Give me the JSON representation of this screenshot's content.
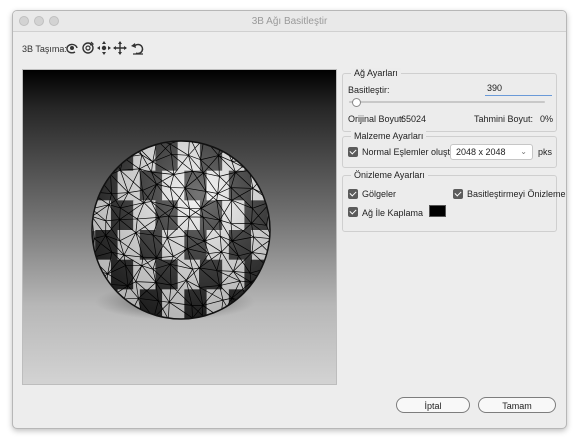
{
  "window": {
    "title": "3B Ağı Basitleştir"
  },
  "toolbar": {
    "label": "3B Taşıma:",
    "tools": [
      "rotate-icon",
      "roll-icon",
      "pan-icon",
      "slide-icon",
      "reset-icon"
    ]
  },
  "mesh_settings": {
    "legend": "Ağ Ayarları",
    "simplify_label": "Basitleştir:",
    "simplify_value": "390",
    "slider_level": 0.02,
    "original_size_label": "Orijinal Boyut:",
    "original_size_value": "65024",
    "estimated_size_label": "Tahmini Boyut:",
    "estimated_size_value": "0%"
  },
  "material_settings": {
    "legend": "Malzeme Ayarları",
    "normal_maps_label": "Normal Eşlemler oluştur",
    "normal_maps_checked": true,
    "size_value": "2048 x 2048",
    "unit": "pks"
  },
  "preview_settings": {
    "legend": "Önizleme Ayarları",
    "shadows_label": "Gölgeler",
    "shadows_checked": true,
    "preview_simplify_label": "Basitleştirmeyi Önizleme",
    "preview_simplify_checked": true,
    "wireframe_label": "Ağ İle Kaplama",
    "wireframe_checked": true,
    "wireframe_color": "#000000"
  },
  "buttons": {
    "cancel": "İptal",
    "ok": "Tamam"
  }
}
